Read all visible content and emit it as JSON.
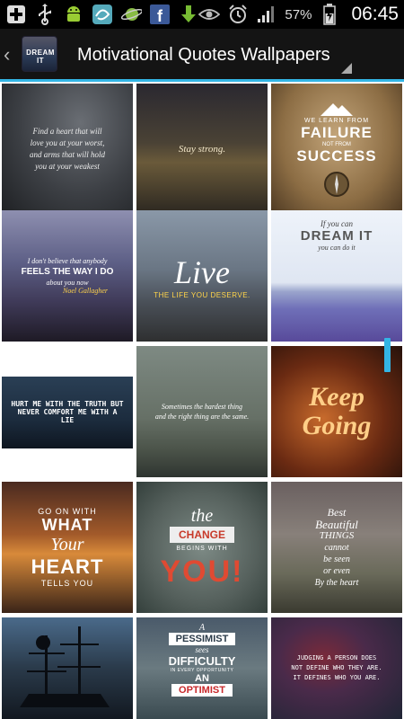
{
  "status_bar": {
    "battery_percent": "57%",
    "time": "06:45",
    "icons": [
      "add-icon",
      "usb-icon",
      "android-debug-icon",
      "app-notification-icon",
      "planet-icon",
      "facebook-icon",
      "download-icon",
      "eye-icon",
      "alarm-icon",
      "signal-icon",
      "battery-icon"
    ]
  },
  "action_bar": {
    "app_icon_text": "DREAM IT",
    "title": "Motivational Quotes Wallpapers"
  },
  "wallpapers": [
    {
      "lines": [
        "Find a heart that will",
        "love you at your worst,",
        "and arms that will hold",
        "you at your weakest"
      ]
    },
    {
      "lines": [
        "Stay strong."
      ]
    },
    {
      "lines": [
        "WE LEARN FROM",
        "FAILURE",
        "NOT FROM",
        "SUCCESS"
      ]
    },
    {
      "lines": [
        "I don't believe that anybody",
        "FEELS THE WAY I DO",
        "about you now",
        "Noel Gallagher"
      ]
    },
    {
      "lines": [
        "Live",
        "THE LIFE YOU DESERVE."
      ]
    },
    {
      "lines": [
        "If you can",
        "DREAM IT",
        "you can do it"
      ]
    },
    {
      "lines": [
        "HURT ME WITH THE TRUTH BUT",
        "NEVER COMFORT ME WITH A LIE"
      ]
    },
    {
      "lines": [
        "Sometimes the hardest thing",
        "and the right thing are the same."
      ]
    },
    {
      "lines": [
        "Keep",
        "Going"
      ]
    },
    {
      "lines": [
        "GO ON WITH",
        "WHAT",
        "Your",
        "HEART",
        "TELLS YOU"
      ]
    },
    {
      "lines": [
        "the",
        "CHANGE",
        "BEGINS WITH",
        "YOU!"
      ]
    },
    {
      "lines": [
        "Best",
        "Beautiful",
        "THINGS",
        "cannot",
        "be seen",
        "or even",
        "By the heart"
      ]
    },
    {
      "lines": []
    },
    {
      "lines": [
        "A",
        "PESSIMIST",
        "sees",
        "DIFFICULTY",
        "IN EVERY OPPORTUNITY",
        "AN",
        "OPTIMIST"
      ]
    },
    {
      "lines": [
        "JUDGING A PERSON DOES",
        "NOT DEFINE WHO THEY ARE.",
        "IT DEFINES WHO YOU ARE."
      ]
    }
  ]
}
